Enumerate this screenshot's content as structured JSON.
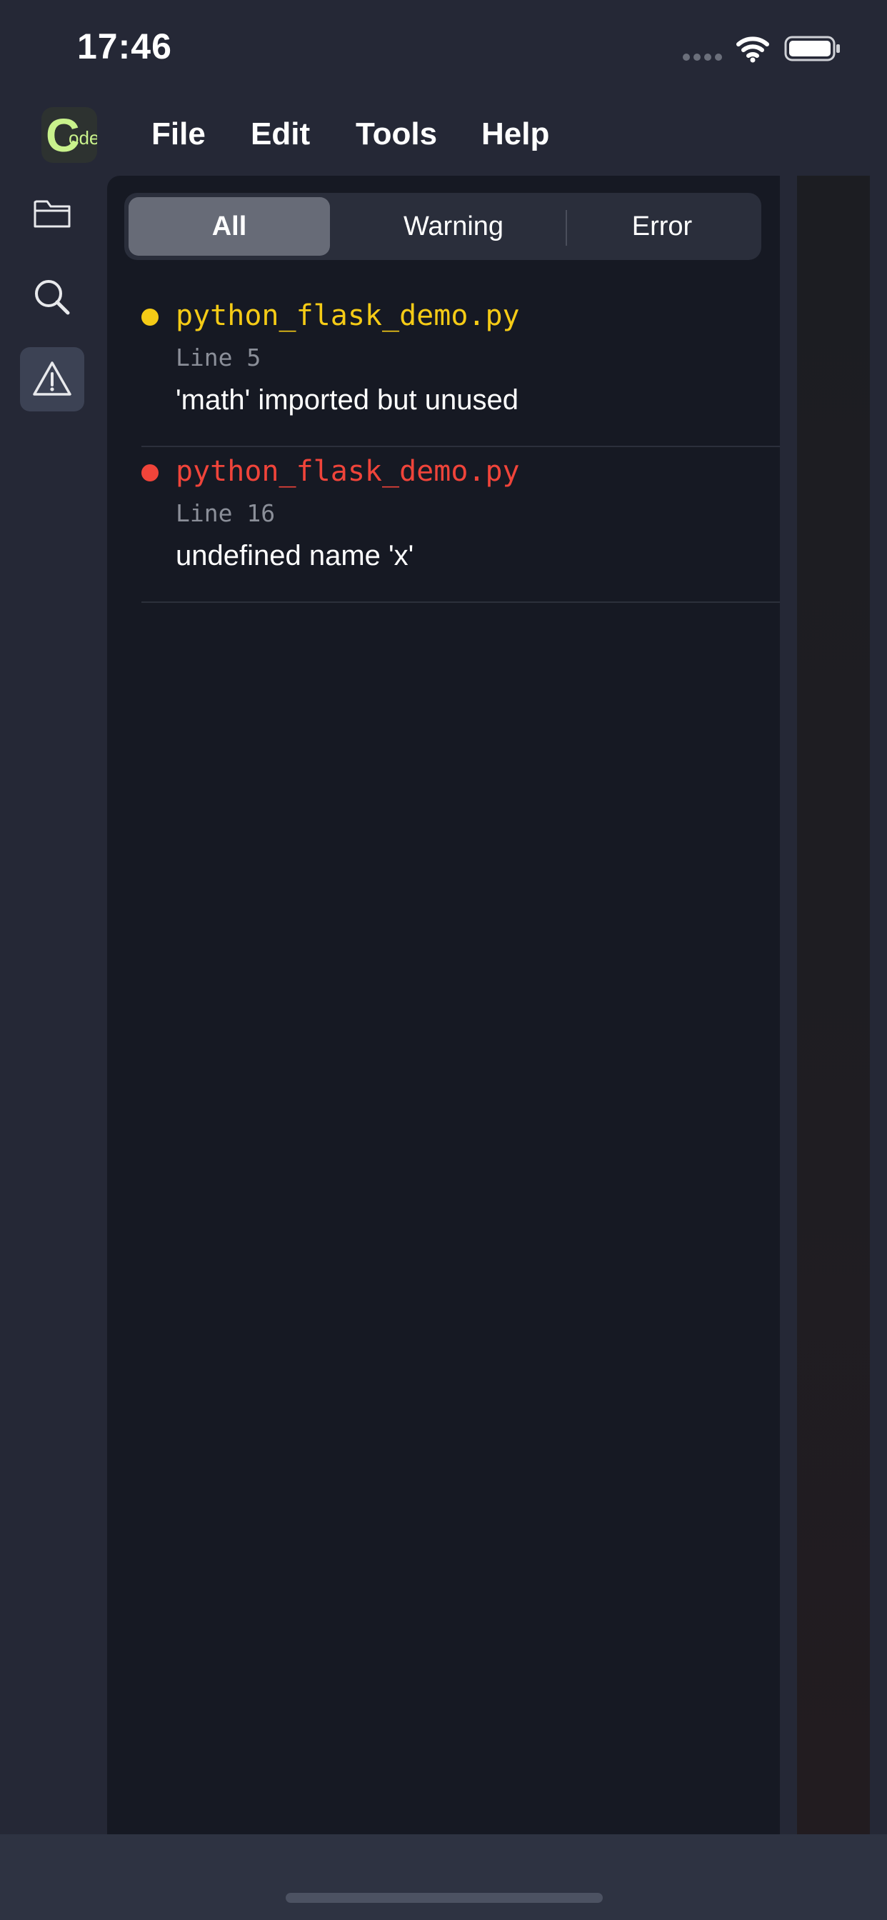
{
  "status_bar": {
    "time": "17:46"
  },
  "app": {
    "logo_letter": "C",
    "logo_suffix": "ode"
  },
  "menu": {
    "items": [
      {
        "label": "File"
      },
      {
        "label": "Edit"
      },
      {
        "label": "Tools"
      },
      {
        "label": "Help"
      }
    ]
  },
  "sidebar": {
    "items": [
      {
        "icon": "folder-icon",
        "active": false
      },
      {
        "icon": "search-icon",
        "active": false
      },
      {
        "icon": "warning-icon",
        "active": true
      }
    ]
  },
  "filter": {
    "segments": [
      {
        "label": "All",
        "selected": true
      },
      {
        "label": "Warning",
        "selected": false
      },
      {
        "label": "Error",
        "selected": false
      }
    ]
  },
  "problems": [
    {
      "severity": "warning",
      "color": "#f5cb16",
      "file": "python_flask_demo.py",
      "line": "Line 5",
      "message": "'math' imported but unused"
    },
    {
      "severity": "error",
      "color": "#f0443a",
      "file": "python_flask_demo.py",
      "line": "Line 16",
      "message": "undefined name 'x'"
    }
  ],
  "colors": {
    "background": "#252836",
    "panel": "#161923",
    "warning": "#f5cb16",
    "error": "#f0443a",
    "logo_green": "#c9f28c"
  }
}
